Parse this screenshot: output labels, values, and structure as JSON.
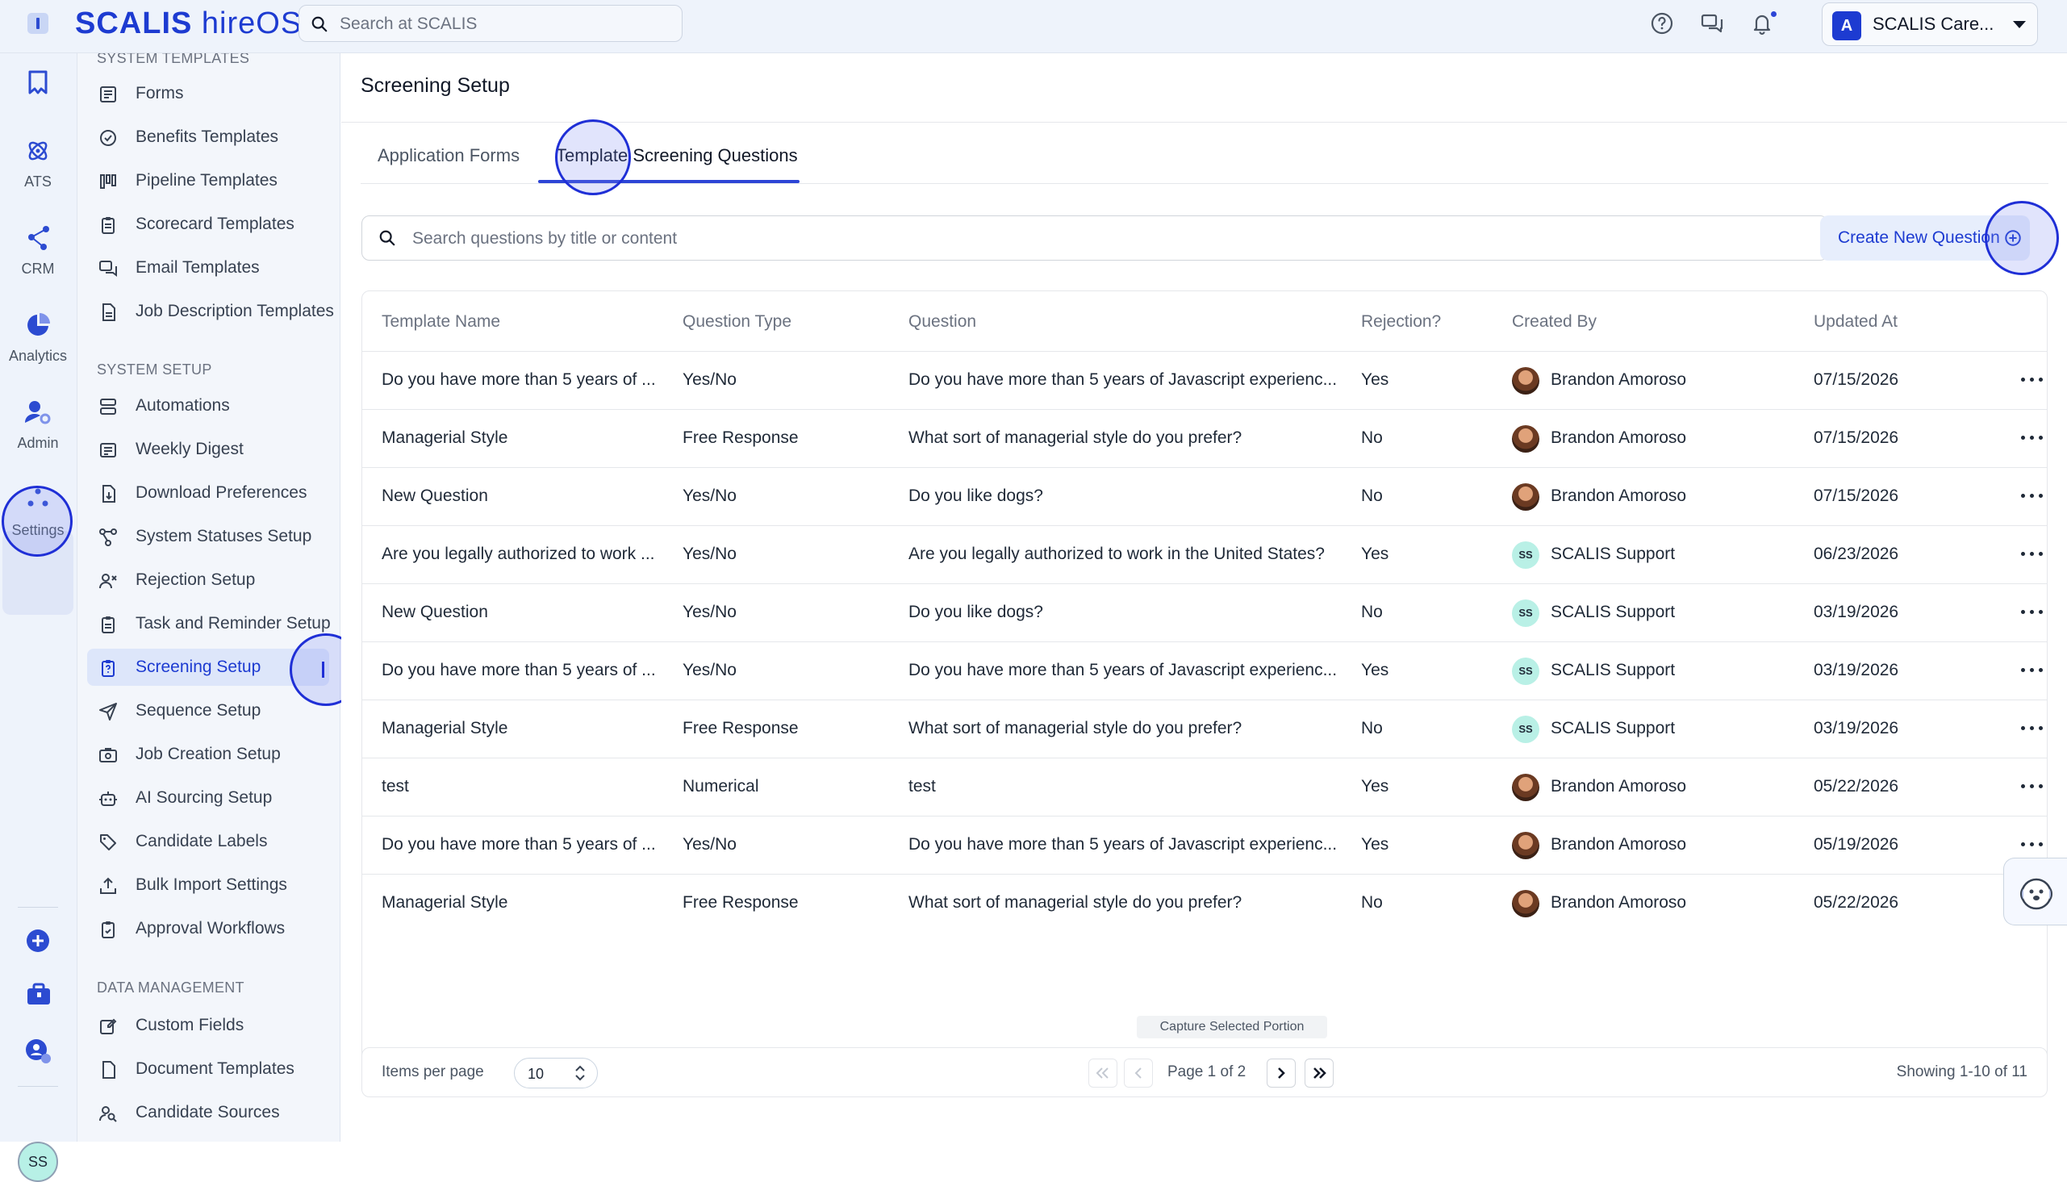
{
  "app": {
    "brand": "SCALIS",
    "brand_suffix": "hireOS"
  },
  "topbar": {
    "search_placeholder": "Search at SCALIS",
    "org_name": "SCALIS Care...",
    "org_initial": "A"
  },
  "rail": {
    "items": [
      {
        "label": "ATS"
      },
      {
        "label": "CRM"
      },
      {
        "label": "Analytics"
      },
      {
        "label": "Admin"
      },
      {
        "label": "Settings"
      }
    ],
    "user_initials": "SS"
  },
  "sidebar": {
    "sections": [
      {
        "title": "SYSTEM TEMPLATES",
        "items": [
          "Forms",
          "Benefits Templates",
          "Pipeline Templates",
          "Scorecard Templates",
          "Email Templates",
          "Job Description Templates"
        ]
      },
      {
        "title": "SYSTEM SETUP",
        "items": [
          "Automations",
          "Weekly Digest",
          "Download Preferences",
          "System Statuses Setup",
          "Rejection Setup",
          "Task and Reminder Setup",
          "Screening Setup",
          "Sequence Setup",
          "Job Creation Setup",
          "AI Sourcing Setup",
          "Candidate Labels",
          "Bulk Import Settings",
          "Approval Workflows"
        ]
      },
      {
        "title": "DATA MANAGEMENT",
        "items": [
          "Custom Fields",
          "Document Templates",
          "Candidate Sources"
        ]
      }
    ]
  },
  "main": {
    "title": "Screening Setup",
    "tabs": [
      {
        "label": "Application Forms"
      },
      {
        "label": "Template Screening Questions"
      }
    ],
    "search_placeholder": "Search questions by title or content",
    "create_label": "Create New Question",
    "columns": [
      "Template Name",
      "Question Type",
      "Question",
      "Rejection?",
      "Created By",
      "Updated At"
    ],
    "rows": [
      {
        "name": "Do you have more than 5 years of ...",
        "type": "Yes/No",
        "question": "Do you have more than 5 years of Javascript experienc...",
        "rejection": "Yes",
        "creator": "Brandon Amoroso",
        "avatar": "photo",
        "updated": "07/15/2026"
      },
      {
        "name": "Managerial Style",
        "type": "Free Response",
        "question": "What sort of managerial style do you prefer?",
        "rejection": "No",
        "creator": "Brandon Amoroso",
        "avatar": "photo",
        "updated": "07/15/2026"
      },
      {
        "name": "New Question",
        "type": "Yes/No",
        "question": "Do you like dogs?",
        "rejection": "No",
        "creator": "Brandon Amoroso",
        "avatar": "photo",
        "updated": "07/15/2026"
      },
      {
        "name": "Are you legally authorized to work ...",
        "type": "Yes/No",
        "question": "Are you legally authorized to work in the United States?",
        "rejection": "Yes",
        "creator": "SCALIS Support",
        "avatar": "SS",
        "updated": "06/23/2026"
      },
      {
        "name": "New Question",
        "type": "Yes/No",
        "question": "Do you like dogs?",
        "rejection": "No",
        "creator": "SCALIS Support",
        "avatar": "SS",
        "updated": "03/19/2026"
      },
      {
        "name": "Do you have more than 5 years of ...",
        "type": "Yes/No",
        "question": "Do you have more than 5 years of Javascript experienc...",
        "rejection": "Yes",
        "creator": "SCALIS Support",
        "avatar": "SS",
        "updated": "03/19/2026"
      },
      {
        "name": "Managerial Style",
        "type": "Free Response",
        "question": "What sort of managerial style do you prefer?",
        "rejection": "No",
        "creator": "SCALIS Support",
        "avatar": "SS",
        "updated": "03/19/2026"
      },
      {
        "name": "test",
        "type": "Numerical",
        "question": "test",
        "rejection": "Yes",
        "creator": "Brandon Amoroso",
        "avatar": "photo",
        "updated": "05/22/2026"
      },
      {
        "name": "Do you have more than 5 years of ...",
        "type": "Yes/No",
        "question": "Do you have more than 5 years of Javascript experienc...",
        "rejection": "Yes",
        "creator": "Brandon Amoroso",
        "avatar": "photo",
        "updated": "05/19/2026"
      },
      {
        "name": "Managerial Style",
        "type": "Free Response",
        "question": "What sort of managerial style do you prefer?",
        "rejection": "No",
        "creator": "Brandon Amoroso",
        "avatar": "photo",
        "updated": "05/22/2026"
      }
    ],
    "capture_label": "Capture Selected Portion",
    "pagination": {
      "items_label": "Items per page",
      "per_page": "10",
      "page_label": "Page 1 of 2",
      "showing": "Showing 1-10 of 11"
    }
  },
  "colors": {
    "accent": "#1d3bd1",
    "active_bg": "#dde6fa",
    "rail_bg": "#eef3fb"
  }
}
